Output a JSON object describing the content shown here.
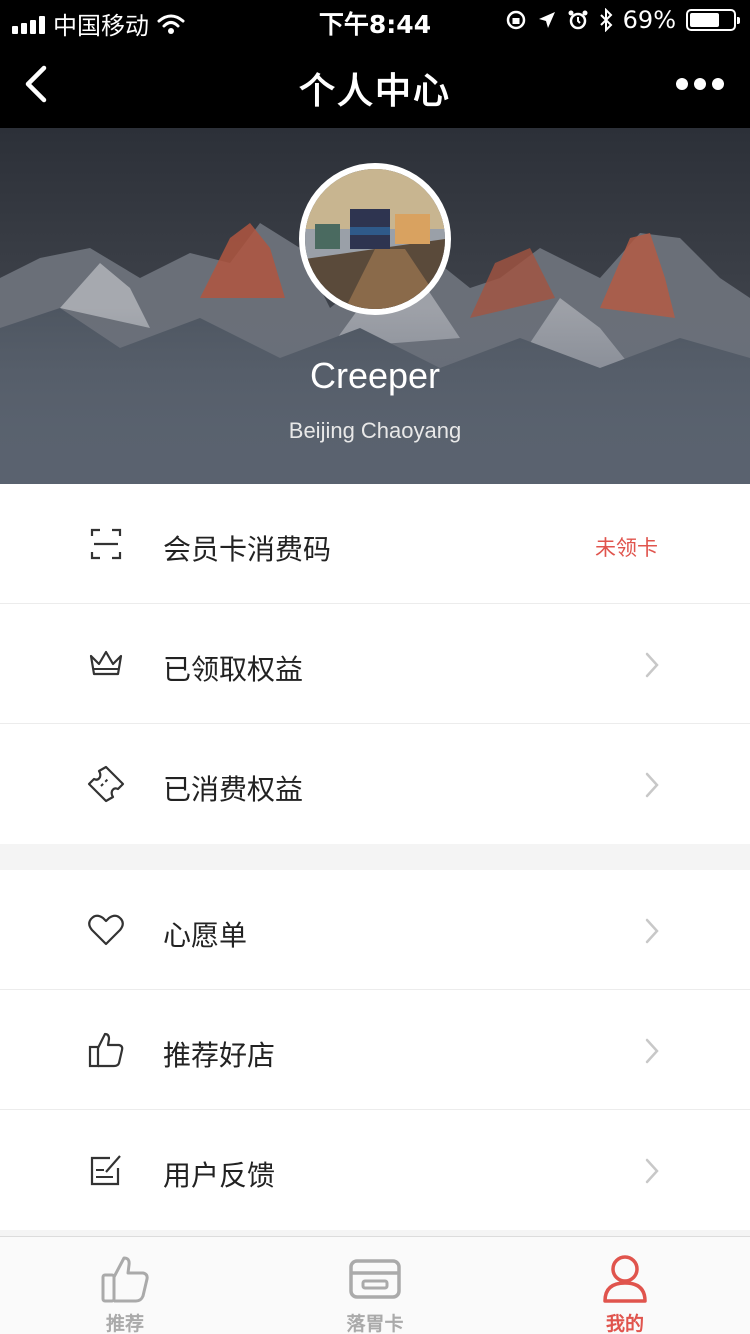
{
  "status_bar": {
    "carrier": "中国移动",
    "time": "下午8:44",
    "battery_percent": "69%",
    "battery_level": 0.69,
    "icons": [
      "signal-icon",
      "wifi-icon",
      "orientation-lock-icon",
      "location-icon",
      "alarm-icon",
      "bluetooth-icon",
      "battery-icon"
    ]
  },
  "nav": {
    "title": "个人中心",
    "back_icon": "chevron-left-icon",
    "more_icon": "more-dots-icon"
  },
  "profile": {
    "name": "Creeper",
    "location": "Beijing Chaoyang"
  },
  "menu_group_1": [
    {
      "icon": "scan-frame-icon",
      "label": "会员卡消费码",
      "status": "未领卡"
    },
    {
      "icon": "crown-icon",
      "label": "已领取权益",
      "status": ""
    },
    {
      "icon": "ticket-icon",
      "label": "已消费权益",
      "status": ""
    }
  ],
  "menu_group_2": [
    {
      "icon": "heart-icon",
      "label": "心愿单",
      "status": ""
    },
    {
      "icon": "thumbs-up-icon",
      "label": "推荐好店",
      "status": ""
    },
    {
      "icon": "edit-note-icon",
      "label": "用户反馈",
      "status": ""
    }
  ],
  "tabs": [
    {
      "icon": "thumbs-up-icon",
      "label": "推荐",
      "active": false
    },
    {
      "icon": "card-icon",
      "label": "落胃卡",
      "active": false
    },
    {
      "icon": "user-icon",
      "label": "我的",
      "active": true
    }
  ],
  "colors": {
    "accent": "#e0544d",
    "inactive": "#aaaaaa",
    "header_bg": "#000000"
  }
}
